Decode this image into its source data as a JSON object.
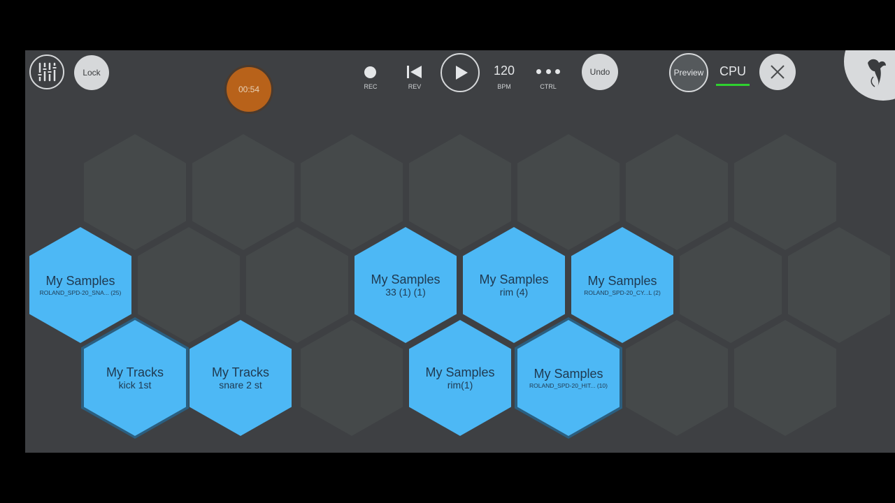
{
  "toolbar": {
    "lock_label": "Lock",
    "timer": "00:54",
    "rec_label": "REC",
    "rev_label": "REV",
    "bpm_value": "120",
    "bpm_label": "BPM",
    "ctrl_label": "CTRL",
    "undo_label": "Undo",
    "preview_label": "Preview",
    "cpu_label": "CPU"
  },
  "colors": {
    "pad_filled": "#4db8f5",
    "pad_empty": "#45494a",
    "background": "#3e4043",
    "timer_orange": "#b8621a",
    "cpu_meter": "#2fd12f"
  },
  "pads": {
    "r2c0": {
      "title": "My Samples",
      "sub": "ROLAND_SPD-20_SNA... (25)"
    },
    "r2c3": {
      "title": "My Samples",
      "sub": "33 (1) (1)"
    },
    "r2c4": {
      "title": "My Samples",
      "sub": "rim (4)"
    },
    "r2c5": {
      "title": "My Samples",
      "sub": "ROLAND_SPD-20_CY...L (2)"
    },
    "r3c0": {
      "title": "My Tracks",
      "sub": "kick 1st"
    },
    "r3c1": {
      "title": "My Tracks",
      "sub": "snare 2 st"
    },
    "r3c3": {
      "title": "My Samples",
      "sub": "rim(1)"
    },
    "r3c4": {
      "title": "My Samples",
      "sub": "ROLAND_SPD-20_HIT... (10)"
    }
  }
}
